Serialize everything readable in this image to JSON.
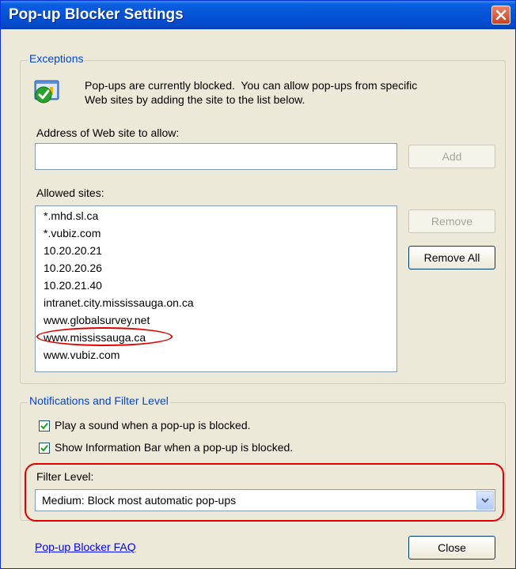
{
  "window": {
    "title": "Pop-up Blocker Settings"
  },
  "exceptions": {
    "legend": "Exceptions",
    "info_line1": "Pop-ups are currently blocked.  You can allow pop-ups from specific",
    "info_line2": "Web sites by adding the site to the list below.",
    "address_label": "Address of Web site to allow:",
    "address_value": "",
    "add_label": "Add",
    "allowed_label": "Allowed sites:",
    "allowed_sites": [
      "*.mhd.sl.ca",
      "*.vubiz.com",
      "10.20.20.21",
      "10.20.20.26",
      "10.20.21.40",
      "intranet.city.mississauga.on.ca",
      "www.globalsurvey.net",
      "www.mississauga.ca",
      "www.vubiz.com"
    ],
    "remove_label": "Remove",
    "remove_all_label": "Remove All"
  },
  "notifications": {
    "legend": "Notifications and Filter Level",
    "play_sound_label": "Play a sound when a pop-up is blocked.",
    "play_sound_checked": true,
    "info_bar_label": "Show Information Bar when a pop-up is blocked.",
    "info_bar_checked": true,
    "filter_label": "Filter Level:",
    "filter_value": "Medium: Block most automatic pop-ups"
  },
  "footer": {
    "faq_link": "Pop-up Blocker FAQ",
    "close_label": "Close"
  },
  "colors": {
    "titlebar": "#0553d6",
    "legend_text": "#0046d5",
    "highlight_annotation": "#e00000"
  }
}
